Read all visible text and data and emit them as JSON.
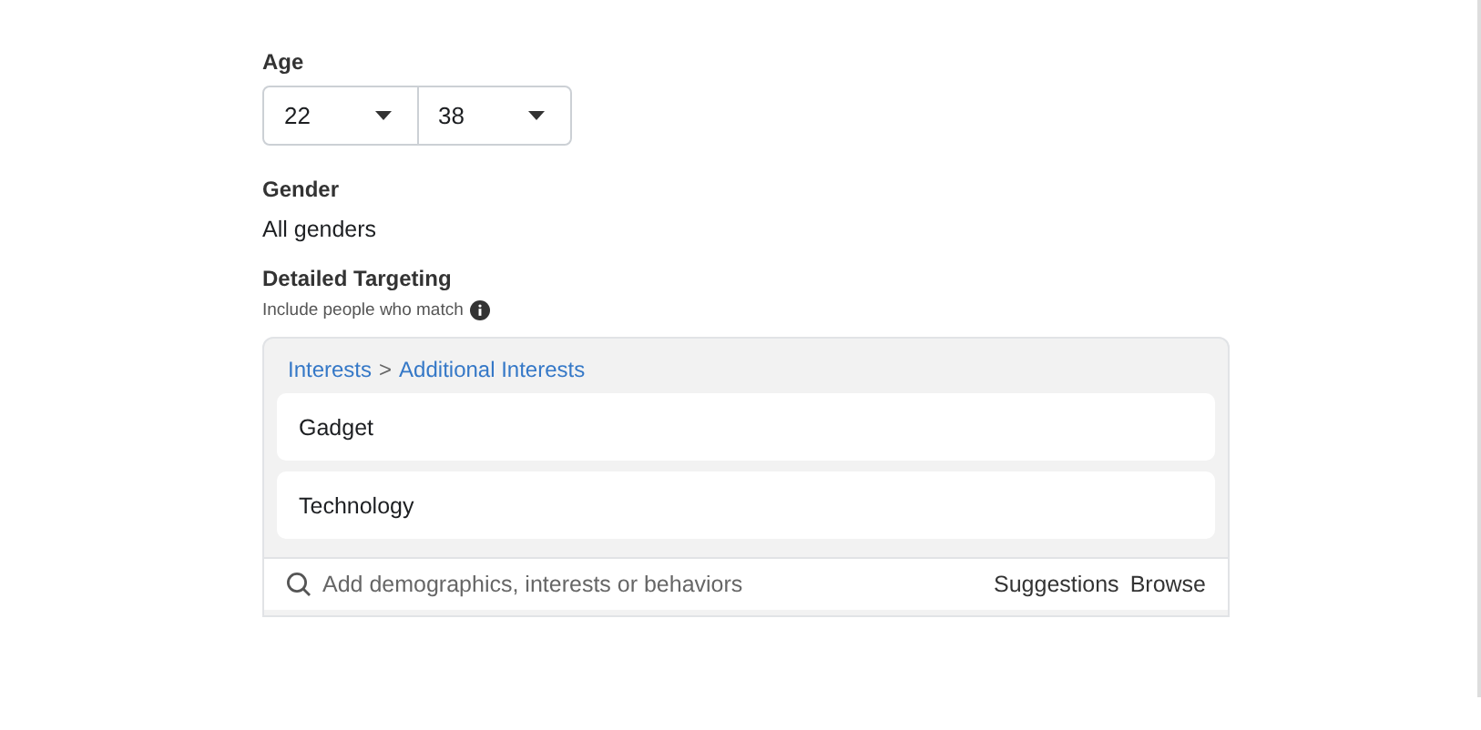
{
  "age": {
    "label": "Age",
    "min": "22",
    "max": "38"
  },
  "gender": {
    "label": "Gender",
    "value": "All genders"
  },
  "detailed_targeting": {
    "label": "Detailed Targeting",
    "hint": "Include people who match",
    "breadcrumb": [
      "Interests",
      ">",
      "Additional Interests"
    ],
    "items": [
      "Gadget",
      "Technology"
    ],
    "search": {
      "placeholder": "Add demographics, interests or behaviors"
    },
    "actions": [
      "Suggestions",
      "Browse"
    ]
  }
}
